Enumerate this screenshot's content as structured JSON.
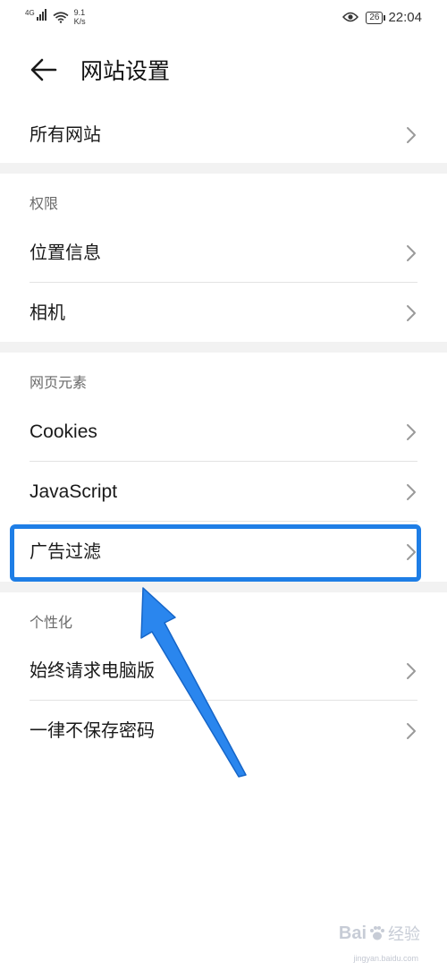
{
  "status_bar": {
    "network": "4G",
    "speed_value": "9.1",
    "speed_unit": "K/s",
    "battery": "26",
    "time": "22:04"
  },
  "header": {
    "title": "网站设置"
  },
  "items": {
    "all_sites": "所有网站",
    "location": "位置信息",
    "camera": "相机",
    "cookies": "Cookies",
    "javascript": "JavaScript",
    "ad_filter": "广告过滤",
    "desktop": "始终请求电脑版",
    "never_save": "一律不保存密码"
  },
  "sections": {
    "permissions": "权限",
    "page_elements": "网页元素",
    "personalization": "个性化"
  },
  "watermark": {
    "text_a": "Bai",
    "text_b": "经验",
    "url": "jingyan.baidu.com"
  },
  "colors": {
    "accent": "#1e7ee6",
    "divider": "#e3e3e3",
    "band": "#f2f2f2"
  }
}
